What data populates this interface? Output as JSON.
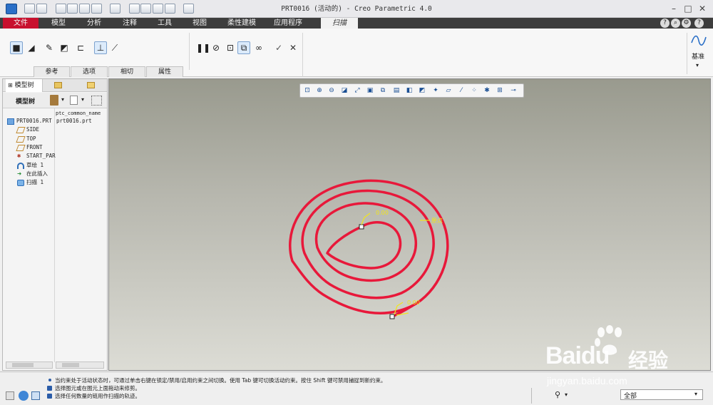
{
  "window": {
    "title": "PRT0016 (活动的) - Creo Parametric 4.0"
  },
  "tabs": [
    {
      "label": "文件",
      "active": false
    },
    {
      "label": "模型",
      "active": false
    },
    {
      "label": "分析",
      "active": false
    },
    {
      "label": "注释",
      "active": false
    },
    {
      "label": "工具",
      "active": false
    },
    {
      "label": "视图",
      "active": false
    },
    {
      "label": "柔性建模",
      "active": false
    },
    {
      "label": "应用程序",
      "active": false
    },
    {
      "label": "扫描",
      "active": true
    }
  ],
  "panel_tabs": [
    "参考",
    "选项",
    "相切",
    "属性"
  ],
  "datum": {
    "label": "基准"
  },
  "model_tree": {
    "tab_label": "模型树",
    "toolbar_label": "模型树",
    "column_header": "ptc_common_name",
    "items": [
      {
        "name": "PRT0016.PRT",
        "value": "prt0016.prt",
        "icon": "part-icon"
      },
      {
        "name": "SIDE",
        "value": "",
        "icon": "datum-plane-icon"
      },
      {
        "name": "TOP",
        "value": "",
        "icon": "datum-plane-icon"
      },
      {
        "name": "FRONT",
        "value": "",
        "icon": "datum-plane-icon"
      },
      {
        "name": "START_PAR",
        "value": "",
        "icon": "coordinate-system-icon"
      },
      {
        "name": "草绘 1",
        "value": "",
        "icon": "sketch-icon"
      },
      {
        "name": "在此插入",
        "value": "",
        "icon": "insert-here-icon"
      },
      {
        "name": "扫描 1",
        "value": "",
        "icon": "sweep-icon"
      }
    ]
  },
  "viewport": {
    "labels": {
      "start": "0.00",
      "origin": "原点",
      "end": "0.00"
    },
    "curve_color": "#e8183a",
    "label_color": "#f2e51a"
  },
  "status": {
    "messages": [
      "当约束处于活动状态时，可通过单击右键在锁定/禁用/启用约束之间切换。使用 Tab 键可切换活动约束。按住 Shift 键可禁用捕捉到新约束。",
      "选择图元或在图元上面拖动来修剪。",
      "选择任何数量的链用作扫描的轨迹。"
    ],
    "filter_value": "全部"
  },
  "watermark": {
    "brand": "Baidu",
    "chinese": "经验",
    "url": "jingyan.baidu.com"
  }
}
